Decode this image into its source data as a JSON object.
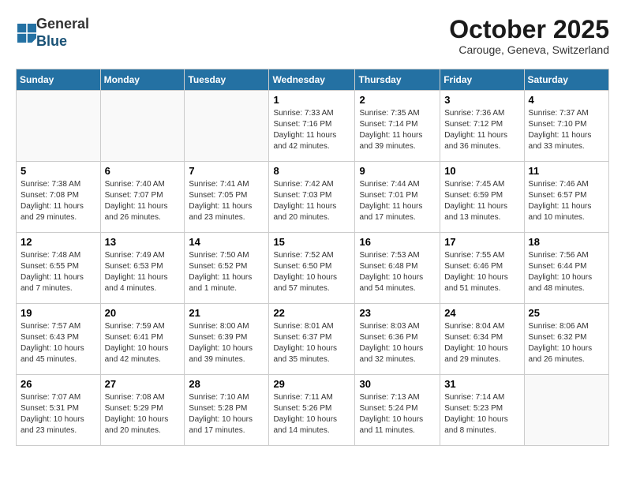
{
  "logo": {
    "general": "General",
    "blue": "Blue"
  },
  "title": "October 2025",
  "subtitle": "Carouge, Geneva, Switzerland",
  "days_header": [
    "Sunday",
    "Monday",
    "Tuesday",
    "Wednesday",
    "Thursday",
    "Friday",
    "Saturday"
  ],
  "weeks": [
    [
      {
        "day": "",
        "info": ""
      },
      {
        "day": "",
        "info": ""
      },
      {
        "day": "",
        "info": ""
      },
      {
        "day": "1",
        "info": "Sunrise: 7:33 AM\nSunset: 7:16 PM\nDaylight: 11 hours and 42 minutes."
      },
      {
        "day": "2",
        "info": "Sunrise: 7:35 AM\nSunset: 7:14 PM\nDaylight: 11 hours and 39 minutes."
      },
      {
        "day": "3",
        "info": "Sunrise: 7:36 AM\nSunset: 7:12 PM\nDaylight: 11 hours and 36 minutes."
      },
      {
        "day": "4",
        "info": "Sunrise: 7:37 AM\nSunset: 7:10 PM\nDaylight: 11 hours and 33 minutes."
      }
    ],
    [
      {
        "day": "5",
        "info": "Sunrise: 7:38 AM\nSunset: 7:08 PM\nDaylight: 11 hours and 29 minutes."
      },
      {
        "day": "6",
        "info": "Sunrise: 7:40 AM\nSunset: 7:07 PM\nDaylight: 11 hours and 26 minutes."
      },
      {
        "day": "7",
        "info": "Sunrise: 7:41 AM\nSunset: 7:05 PM\nDaylight: 11 hours and 23 minutes."
      },
      {
        "day": "8",
        "info": "Sunrise: 7:42 AM\nSunset: 7:03 PM\nDaylight: 11 hours and 20 minutes."
      },
      {
        "day": "9",
        "info": "Sunrise: 7:44 AM\nSunset: 7:01 PM\nDaylight: 11 hours and 17 minutes."
      },
      {
        "day": "10",
        "info": "Sunrise: 7:45 AM\nSunset: 6:59 PM\nDaylight: 11 hours and 13 minutes."
      },
      {
        "day": "11",
        "info": "Sunrise: 7:46 AM\nSunset: 6:57 PM\nDaylight: 11 hours and 10 minutes."
      }
    ],
    [
      {
        "day": "12",
        "info": "Sunrise: 7:48 AM\nSunset: 6:55 PM\nDaylight: 11 hours and 7 minutes."
      },
      {
        "day": "13",
        "info": "Sunrise: 7:49 AM\nSunset: 6:53 PM\nDaylight: 11 hours and 4 minutes."
      },
      {
        "day": "14",
        "info": "Sunrise: 7:50 AM\nSunset: 6:52 PM\nDaylight: 11 hours and 1 minute."
      },
      {
        "day": "15",
        "info": "Sunrise: 7:52 AM\nSunset: 6:50 PM\nDaylight: 10 hours and 57 minutes."
      },
      {
        "day": "16",
        "info": "Sunrise: 7:53 AM\nSunset: 6:48 PM\nDaylight: 10 hours and 54 minutes."
      },
      {
        "day": "17",
        "info": "Sunrise: 7:55 AM\nSunset: 6:46 PM\nDaylight: 10 hours and 51 minutes."
      },
      {
        "day": "18",
        "info": "Sunrise: 7:56 AM\nSunset: 6:44 PM\nDaylight: 10 hours and 48 minutes."
      }
    ],
    [
      {
        "day": "19",
        "info": "Sunrise: 7:57 AM\nSunset: 6:43 PM\nDaylight: 10 hours and 45 minutes."
      },
      {
        "day": "20",
        "info": "Sunrise: 7:59 AM\nSunset: 6:41 PM\nDaylight: 10 hours and 42 minutes."
      },
      {
        "day": "21",
        "info": "Sunrise: 8:00 AM\nSunset: 6:39 PM\nDaylight: 10 hours and 39 minutes."
      },
      {
        "day": "22",
        "info": "Sunrise: 8:01 AM\nSunset: 6:37 PM\nDaylight: 10 hours and 35 minutes."
      },
      {
        "day": "23",
        "info": "Sunrise: 8:03 AM\nSunset: 6:36 PM\nDaylight: 10 hours and 32 minutes."
      },
      {
        "day": "24",
        "info": "Sunrise: 8:04 AM\nSunset: 6:34 PM\nDaylight: 10 hours and 29 minutes."
      },
      {
        "day": "25",
        "info": "Sunrise: 8:06 AM\nSunset: 6:32 PM\nDaylight: 10 hours and 26 minutes."
      }
    ],
    [
      {
        "day": "26",
        "info": "Sunrise: 7:07 AM\nSunset: 5:31 PM\nDaylight: 10 hours and 23 minutes."
      },
      {
        "day": "27",
        "info": "Sunrise: 7:08 AM\nSunset: 5:29 PM\nDaylight: 10 hours and 20 minutes."
      },
      {
        "day": "28",
        "info": "Sunrise: 7:10 AM\nSunset: 5:28 PM\nDaylight: 10 hours and 17 minutes."
      },
      {
        "day": "29",
        "info": "Sunrise: 7:11 AM\nSunset: 5:26 PM\nDaylight: 10 hours and 14 minutes."
      },
      {
        "day": "30",
        "info": "Sunrise: 7:13 AM\nSunset: 5:24 PM\nDaylight: 10 hours and 11 minutes."
      },
      {
        "day": "31",
        "info": "Sunrise: 7:14 AM\nSunset: 5:23 PM\nDaylight: 10 hours and 8 minutes."
      },
      {
        "day": "",
        "info": ""
      }
    ]
  ]
}
